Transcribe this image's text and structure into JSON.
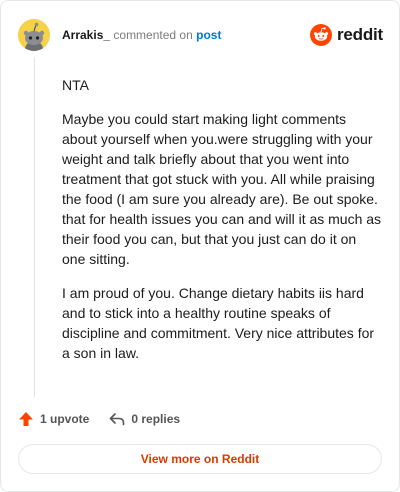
{
  "header": {
    "username": "Arrakis_",
    "action_text": "commented on",
    "post_link": "post",
    "logo_text": "reddit"
  },
  "comment": {
    "paragraphs": [
      "NTA",
      "Maybe you could start making light comments about yourself when you.were struggling with your weight and talk briefly about that you went into treatment that got stuck with you. All while praising the food (I am sure you already are). Be out spoke. that for health issues you can and will it as much as their food you can, but that you just can do it on one sitting.",
      "I am proud of you. Change dietary habits iis hard and to stick into a healthy routine speaks of discipline and commitment. Very nice attributes for a son in law."
    ]
  },
  "actions": {
    "upvote_label": "1 upvote",
    "replies_label": "0 replies"
  },
  "footer": {
    "view_more_label": "View more on Reddit"
  },
  "colors": {
    "brand": "#ff4500",
    "link": "#0079d3",
    "view_more": "#d93a00",
    "avatar_bg": "#f6d24a"
  },
  "icons": {
    "avatar": "snoo-avatar-icon",
    "logo": "reddit-snoo-icon",
    "upvote": "upvote-arrow-icon",
    "reply": "reply-arrow-icon"
  }
}
